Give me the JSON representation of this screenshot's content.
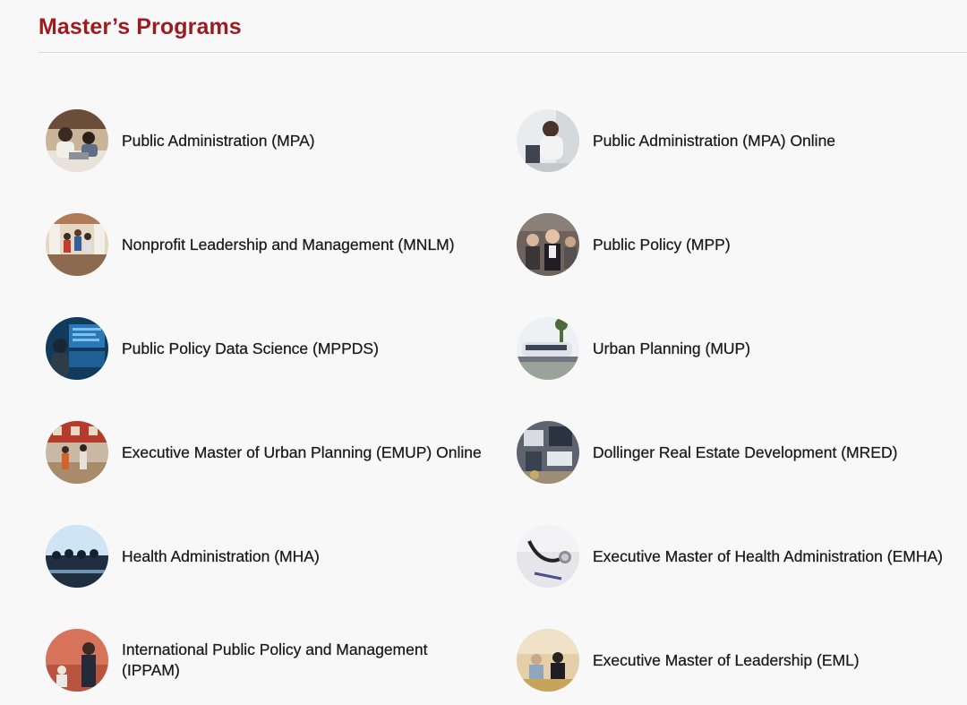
{
  "section": {
    "title": "Master’s Programs"
  },
  "programs": [
    {
      "label": "Public Administration (MPA)",
      "image": "students-at-table-photo"
    },
    {
      "label": "Public Administration (MPA) Online",
      "image": "woman-at-laptop-photo"
    },
    {
      "label": "Nonprofit Leadership and Management (MNLM)",
      "image": "volunteers-celebrating-photo"
    },
    {
      "label": "Public Policy (MPP)",
      "image": "meeting-participants-photo"
    },
    {
      "label": "Public Policy Data Science (MPPDS)",
      "image": "data-screens-photo"
    },
    {
      "label": "Urban Planning (MUP)",
      "image": "monorail-train-photo"
    },
    {
      "label": "Executive Master of Urban Planning (EMUP) Online",
      "image": "street-pedestrians-photo"
    },
    {
      "label": "Dollinger Real Estate Development (MRED)",
      "image": "aerial-buildings-photo"
    },
    {
      "label": "Health Administration (MHA)",
      "image": "conference-silhouettes-photo"
    },
    {
      "label": "Executive Master of Health Administration (EMHA)",
      "image": "stethoscope-photo"
    },
    {
      "label": "International Public Policy and Management (IPPAM)",
      "image": "speaker-presenting-photo"
    },
    {
      "label": "Executive Master of Leadership (EML)",
      "image": "colleagues-discussion-photo"
    }
  ],
  "colors": {
    "accent": "#9b1b1f",
    "background": "#f8f8f9",
    "text": "#1a1a1a",
    "rule": "#d8d8db"
  }
}
